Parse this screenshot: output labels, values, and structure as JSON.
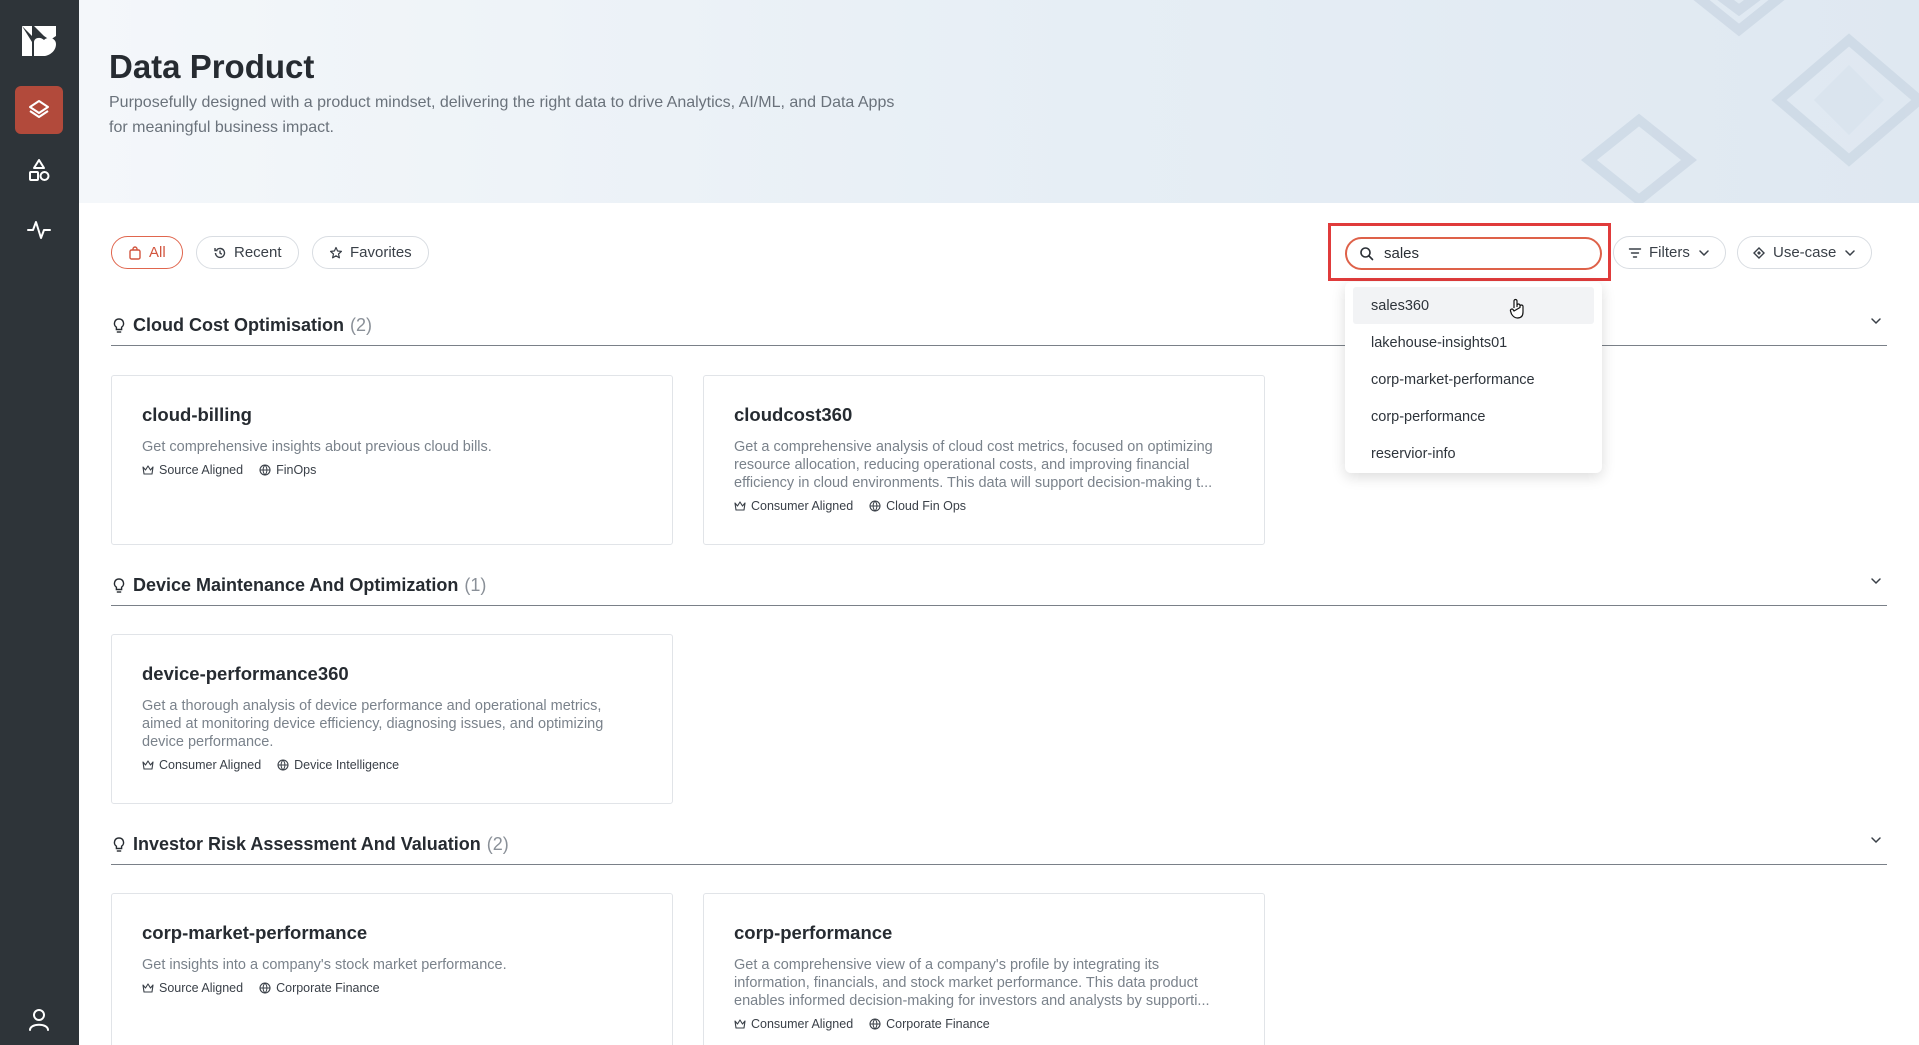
{
  "header": {
    "title": "Data Product",
    "subtitle": "Purposefully designed with a product mindset, delivering the right data to drive Analytics, AI/ML, and Data Apps for meaningful business impact."
  },
  "sidebar": {
    "items": [
      {
        "icon": "data-product-icon",
        "active": true
      },
      {
        "icon": "shapes-icon",
        "active": false
      },
      {
        "icon": "activity-icon",
        "active": false
      }
    ],
    "user_icon": "user-icon"
  },
  "toolbar": {
    "tabs": [
      {
        "label": "All",
        "icon": "bag-icon",
        "active": true
      },
      {
        "label": "Recent",
        "icon": "history-icon",
        "active": false
      },
      {
        "label": "Favorites",
        "icon": "star-icon",
        "active": false
      }
    ],
    "search": {
      "value": "sales",
      "placeholder": "Search"
    },
    "filters_label": "Filters",
    "usecase_label": "Use-case"
  },
  "suggestions": [
    "sales360",
    "lakehouse-insights01",
    "corp-market-performance",
    "corp-performance",
    "reservior-info"
  ],
  "sections": [
    {
      "title": "Cloud Cost Optimisation",
      "count": "(2)",
      "cards": [
        {
          "name": "cloud-billing",
          "desc": "Get comprehensive insights about previous cloud bills.",
          "alignment": "Source Aligned",
          "domain": "FinOps"
        },
        {
          "name": "cloudcost360",
          "desc": "Get a comprehensive analysis of cloud cost metrics, focused on optimizing resource allocation, reducing operational costs, and improving financial efficiency in cloud environments. This data will support decision-making t...",
          "alignment": "Consumer Aligned",
          "domain": "Cloud Fin Ops"
        }
      ]
    },
    {
      "title": "Device Maintenance And Optimization",
      "count": "(1)",
      "cards": [
        {
          "name": "device-performance360",
          "desc": "Get a thorough analysis of device performance and operational metrics, aimed at monitoring device efficiency, diagnosing issues, and optimizing device performance.",
          "alignment": "Consumer Aligned",
          "domain": "Device Intelligence"
        }
      ]
    },
    {
      "title": "Investor Risk Assessment And Valuation",
      "count": "(2)",
      "cards": [
        {
          "name": "corp-market-performance",
          "desc": "Get insights into a company's stock market performance.",
          "alignment": "Source Aligned",
          "domain": "Corporate Finance"
        },
        {
          "name": "corp-performance",
          "desc": "Get a comprehensive view of a company's profile by integrating its information, financials, and stock market performance. This data product enables informed decision-making for investors and analysts by supporti...",
          "alignment": "Consumer Aligned",
          "domain": "Corporate Finance"
        }
      ]
    }
  ],
  "colors": {
    "accent": "#de6149",
    "sidebar": "#2e3439",
    "active_nav": "#b24a3b",
    "highlight": "#e03b3b"
  }
}
